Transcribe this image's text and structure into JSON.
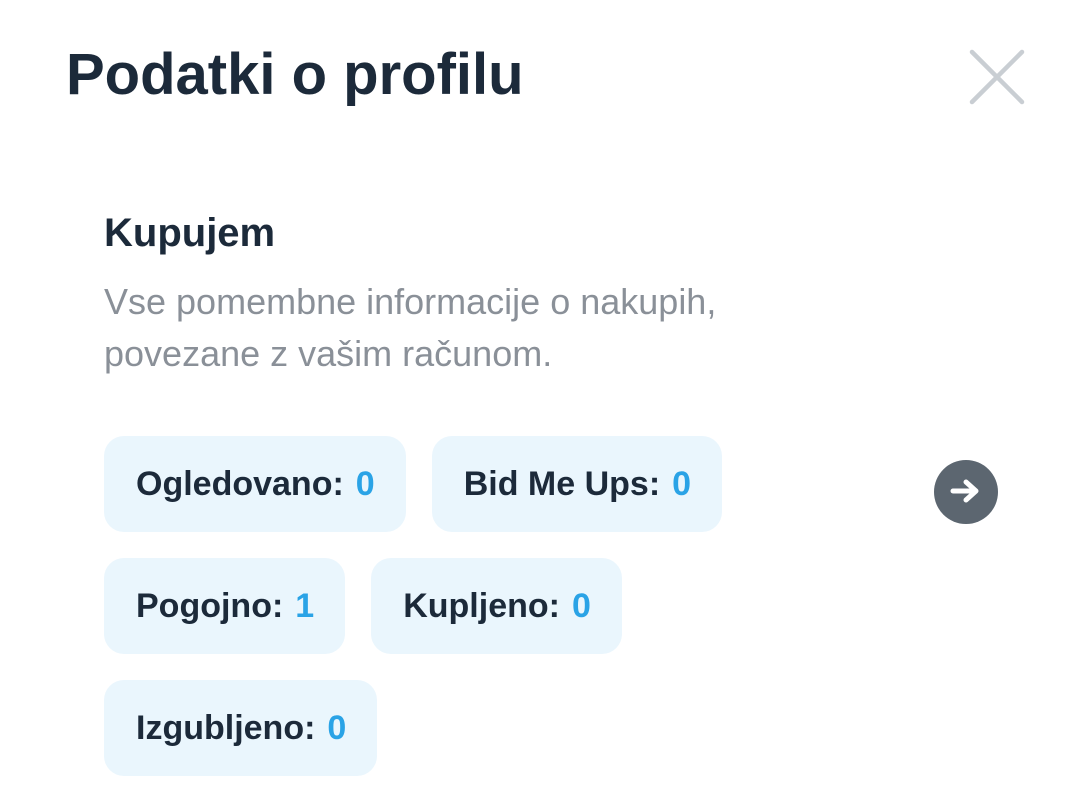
{
  "dialog": {
    "title": "Podatki o profilu",
    "close_icon": "close-icon"
  },
  "buying": {
    "heading": "Kupujem",
    "description": "Vse pomembne informacije o nakupih, povezane z vašim računom.",
    "stats": [
      {
        "label": "Ogledovano:",
        "value": "0"
      },
      {
        "label": "Bid Me Ups:",
        "value": "0"
      },
      {
        "label": "Pogojno:",
        "value": "1"
      },
      {
        "label": "Kupljeno:",
        "value": "0"
      },
      {
        "label": "Izgubljeno:",
        "value": "0"
      }
    ],
    "more_icon": "arrow-right-circle-icon"
  },
  "colors": {
    "heading": "#1c2a3a",
    "muted_text": "#8a9098",
    "chip_background": "#eaf6fd",
    "value_accent": "#2aa3e6",
    "arrow_button": "#5c6670",
    "close_icon": "#c9ced3"
  }
}
